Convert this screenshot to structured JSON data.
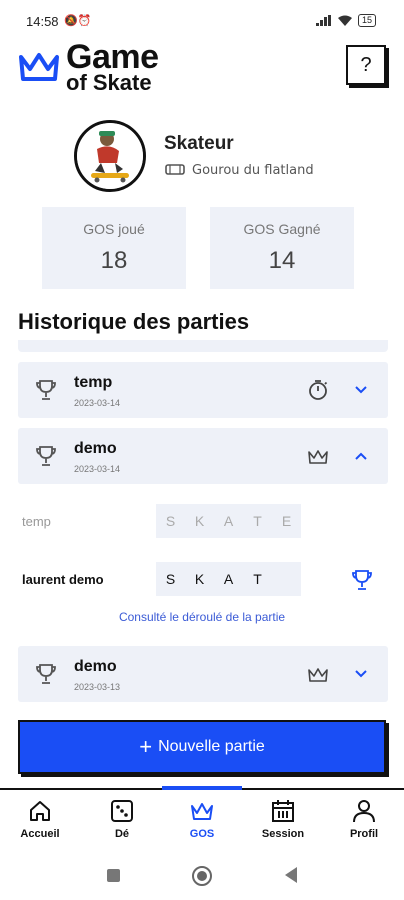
{
  "status_bar": {
    "time": "14:58",
    "battery": "15"
  },
  "app": {
    "logo_line1": "Game",
    "logo_line2": "of Skate",
    "help_label": "?"
  },
  "profile": {
    "name": "Skateur",
    "level": "Gourou du flatland"
  },
  "stats": [
    {
      "label": "GOS joué",
      "value": "18"
    },
    {
      "label": "GOS Gagné",
      "value": "14"
    }
  ],
  "history": {
    "title": "Historique des parties",
    "games": [
      {
        "name": "temp",
        "date": "2023-03-14",
        "status_icon": "timer-icon",
        "expanded": false
      },
      {
        "name": "demo",
        "date": "2023-03-14",
        "status_icon": "crown-icon",
        "expanded": true
      },
      {
        "name": "demo",
        "date": "2023-03-13",
        "status_icon": "crown-icon",
        "expanded": false
      }
    ],
    "expanded_detail": {
      "players": [
        {
          "name": "temp",
          "letters": [
            "S",
            "K",
            "A",
            "T",
            "E"
          ],
          "winner": false
        },
        {
          "name": "laurent demo",
          "letters": [
            "S",
            "K",
            "A",
            "T",
            ""
          ],
          "winner": true
        }
      ],
      "link": "Consulté le déroulé de la partie"
    }
  },
  "new_game_button": {
    "label": "Nouvelle partie"
  },
  "bottom_nav": {
    "items": [
      {
        "label": "Accueil",
        "icon": "home-icon"
      },
      {
        "label": "Dé",
        "icon": "dice-icon"
      },
      {
        "label": "GOS",
        "icon": "crown-icon",
        "active": true
      },
      {
        "label": "Session",
        "icon": "calendar-icon"
      },
      {
        "label": "Profil",
        "icon": "user-icon"
      }
    ]
  },
  "colors": {
    "accent": "#1a4ef5",
    "card_bg": "#eef1f8",
    "text": "#111111",
    "muted": "#777777"
  }
}
